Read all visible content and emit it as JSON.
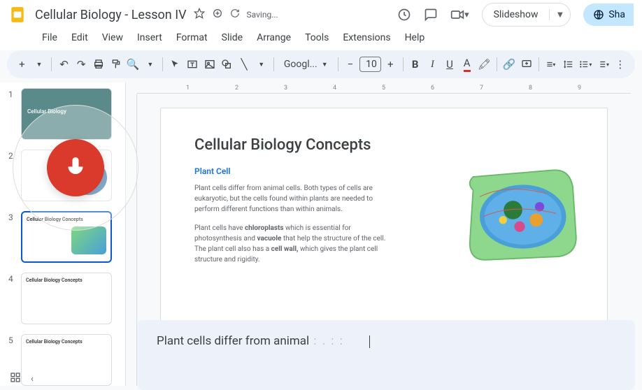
{
  "doc": {
    "title": "Cellular Biology - Lesson IV",
    "saving": "Saving..."
  },
  "menus": {
    "file": "File",
    "edit": "Edit",
    "view": "View",
    "insert": "Insert",
    "format": "Format",
    "slide": "Slide",
    "arrange": "Arrange",
    "tools": "Tools",
    "extensions": "Extensions",
    "help": "Help"
  },
  "toolbar": {
    "font": "Googl...",
    "size": "10"
  },
  "actions": {
    "slideshow": "Slideshow",
    "share": "Sha"
  },
  "thumbs": {
    "n1": "1",
    "n2": "2",
    "n3": "3",
    "n4": "4",
    "n5": "5",
    "t3": "Cellular Biology Concepts",
    "t4": "Cellular Biology Concepts",
    "t5": "Cellular Biology Concepts"
  },
  "slide": {
    "title": "Cellular Biology Concepts",
    "subtitle": "Plant Cell",
    "p1": "Plant cells differ from animal cells. Both types of cells are eukaryotic, but the cells found within plants are needed to perform different functions than within animals.",
    "p2a": "Plant cells have ",
    "p2b": "chloroplasts",
    "p2c": " which is essential for photosynthesis and ",
    "p2d": "vacuole",
    "p2e": " that help the structure of the cell. The plant cell also has a ",
    "p2f": "cell wall,",
    "p2g": " which gives the plant cell structure and rigidity."
  },
  "notes": {
    "text": "Plant cells differ from animal"
  },
  "ruler": {
    "r1": "1",
    "r2": "2",
    "r3": "3",
    "r4": "4",
    "r5": "5",
    "r6": "6",
    "r7": "7",
    "r8": "8",
    "r9": "9"
  }
}
